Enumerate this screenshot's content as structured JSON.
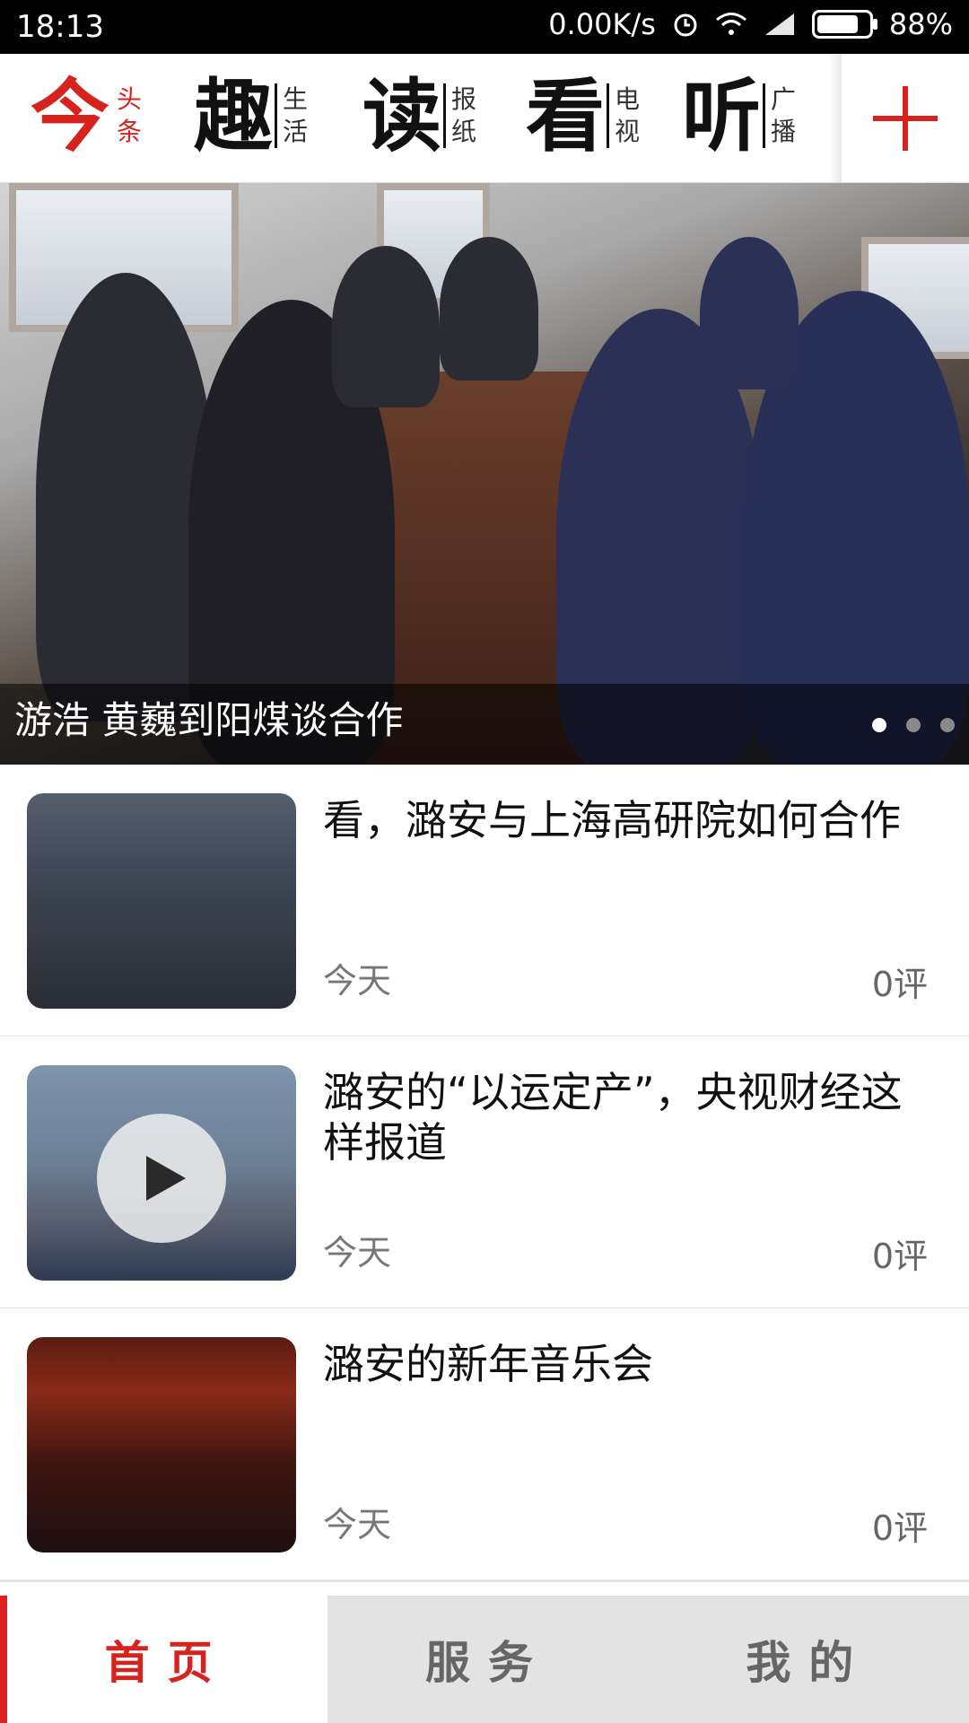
{
  "status_bar": {
    "time": "18:13",
    "speed": "0.00K/s",
    "battery": "88%",
    "icons": [
      "alarm-icon",
      "wifi-icon",
      "signal-icon",
      "battery-icon"
    ]
  },
  "top_nav": {
    "items": [
      {
        "big": "今",
        "small": [
          "头",
          "条"
        ],
        "active": true
      },
      {
        "big": "趣",
        "small": [
          "生",
          "活"
        ],
        "active": false
      },
      {
        "big": "读",
        "small": [
          "报",
          "纸"
        ],
        "active": false
      },
      {
        "big": "看",
        "small": [
          "电",
          "视"
        ],
        "active": false
      },
      {
        "big": "听",
        "small": [
          "广",
          "播"
        ],
        "active": false
      }
    ],
    "add_icon": "plus-icon"
  },
  "hero": {
    "caption": "游浩 黄巍到阳煤谈合作",
    "slide_count": 3,
    "active_slide": 1
  },
  "news": [
    {
      "title": "看，潞安与上海高研院如何合作",
      "date": "今天",
      "comments": "0评",
      "video": false
    },
    {
      "title": "潞安的“以运定产”，央视财经这样报道",
      "date": "今天",
      "comments": "0评",
      "video": true
    },
    {
      "title": "潞安的新年音乐会",
      "date": "今天",
      "comments": "0评",
      "video": false
    }
  ],
  "tabs": [
    {
      "label": "首页",
      "active": true
    },
    {
      "label": "服务",
      "active": false
    },
    {
      "label": "我的",
      "active": false
    }
  ],
  "colors": {
    "accent": "#d6231e",
    "tab_bg": "#e3e3e3"
  }
}
